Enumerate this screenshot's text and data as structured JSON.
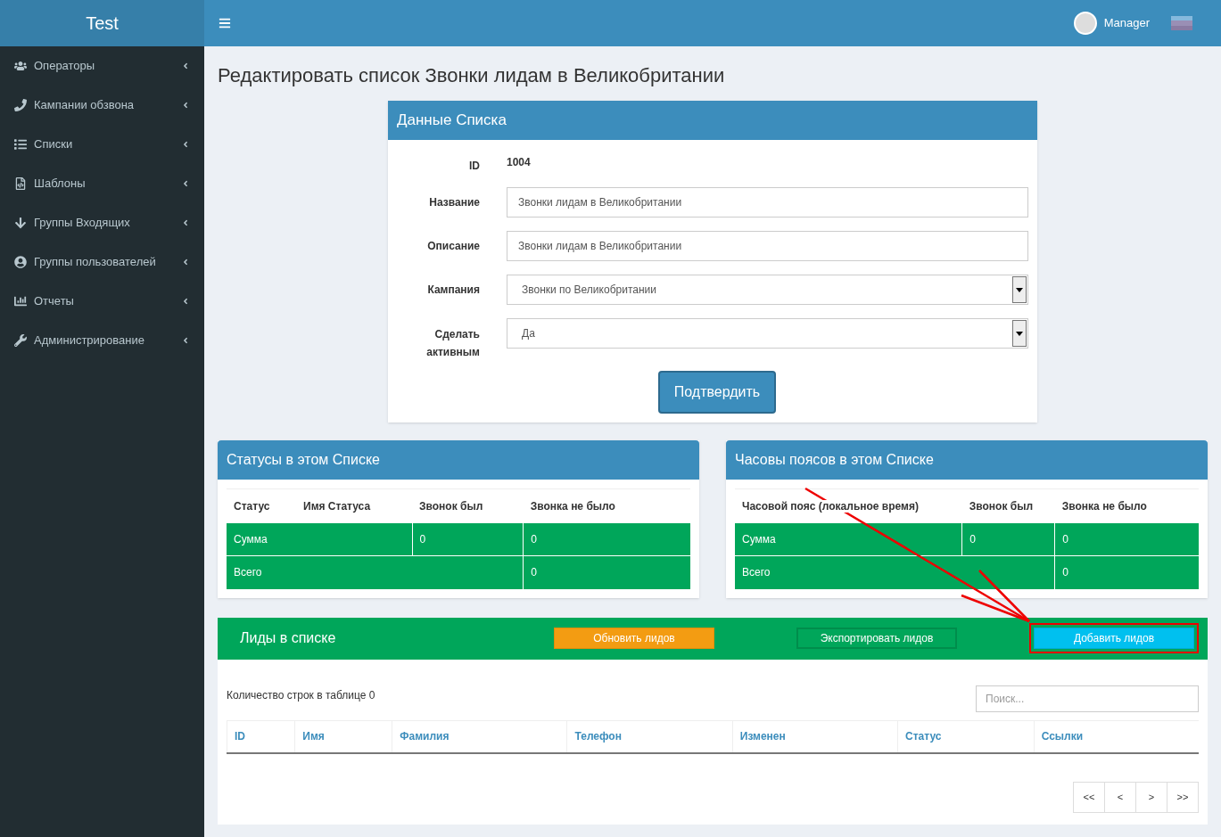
{
  "brand": "Test",
  "user": {
    "name": "Manager"
  },
  "sidebar": {
    "items": [
      {
        "label": "Операторы"
      },
      {
        "label": "Кампании обзвона"
      },
      {
        "label": "Списки"
      },
      {
        "label": "Шаблоны"
      },
      {
        "label": "Группы Входящих"
      },
      {
        "label": "Группы пользователей"
      },
      {
        "label": "Отчеты"
      },
      {
        "label": "Администрирование"
      }
    ]
  },
  "page_title": "Редактировать список Звонки лидам в Великобритании",
  "form": {
    "title": "Данные Списка",
    "fields": [
      {
        "kind": "text",
        "label": "ID",
        "value": "1004"
      },
      {
        "kind": "input",
        "label": "Название",
        "value": "Звонки лидам в Великобритании"
      },
      {
        "kind": "input",
        "label": "Описание",
        "value": "Звонки лидам в Великобритании"
      },
      {
        "kind": "select",
        "label": "Кампания",
        "value": "Звонки по Великобритании"
      },
      {
        "kind": "select",
        "label": "Сделать активным",
        "value": "Да"
      }
    ],
    "submit": "Подтвердить"
  },
  "stat_tables": [
    {
      "title": "Статусы в этом Списке",
      "columns": [
        "Статус",
        "Имя Статуса",
        "Звонок был",
        "Звонка не было"
      ],
      "rows": [
        [
          "Сумма",
          "",
          "0",
          "0"
        ],
        [
          "Всего",
          "",
          "",
          "0"
        ]
      ]
    },
    {
      "title": "Часовы поясов в этом Списке",
      "columns": [
        "Часовой пояс (локальное время)",
        "Звонок был",
        "Звонка не было"
      ],
      "rows": [
        [
          "Сумма",
          "0",
          "0"
        ],
        [
          "Всего",
          "",
          "0"
        ]
      ]
    }
  ],
  "leads": {
    "title": "Лиды в списке",
    "buttons": [
      {
        "label": "Обновить лидов",
        "kind": "orange",
        "highlighted": false
      },
      {
        "label": "Экспортировать лидов",
        "kind": "green",
        "highlighted": false
      },
      {
        "label": "Добавить лидов",
        "kind": "cyan",
        "highlighted": true
      }
    ],
    "row_count": "Количество строк в таблице 0",
    "search": {
      "placeholder": "Поиск..."
    },
    "columns": [
      "ID",
      "Имя",
      "Фамилия",
      "Телефон",
      "Изменен",
      "Статус",
      "Ссылки"
    ],
    "pagination": [
      "<<",
      "<",
      ">",
      ">>"
    ]
  }
}
